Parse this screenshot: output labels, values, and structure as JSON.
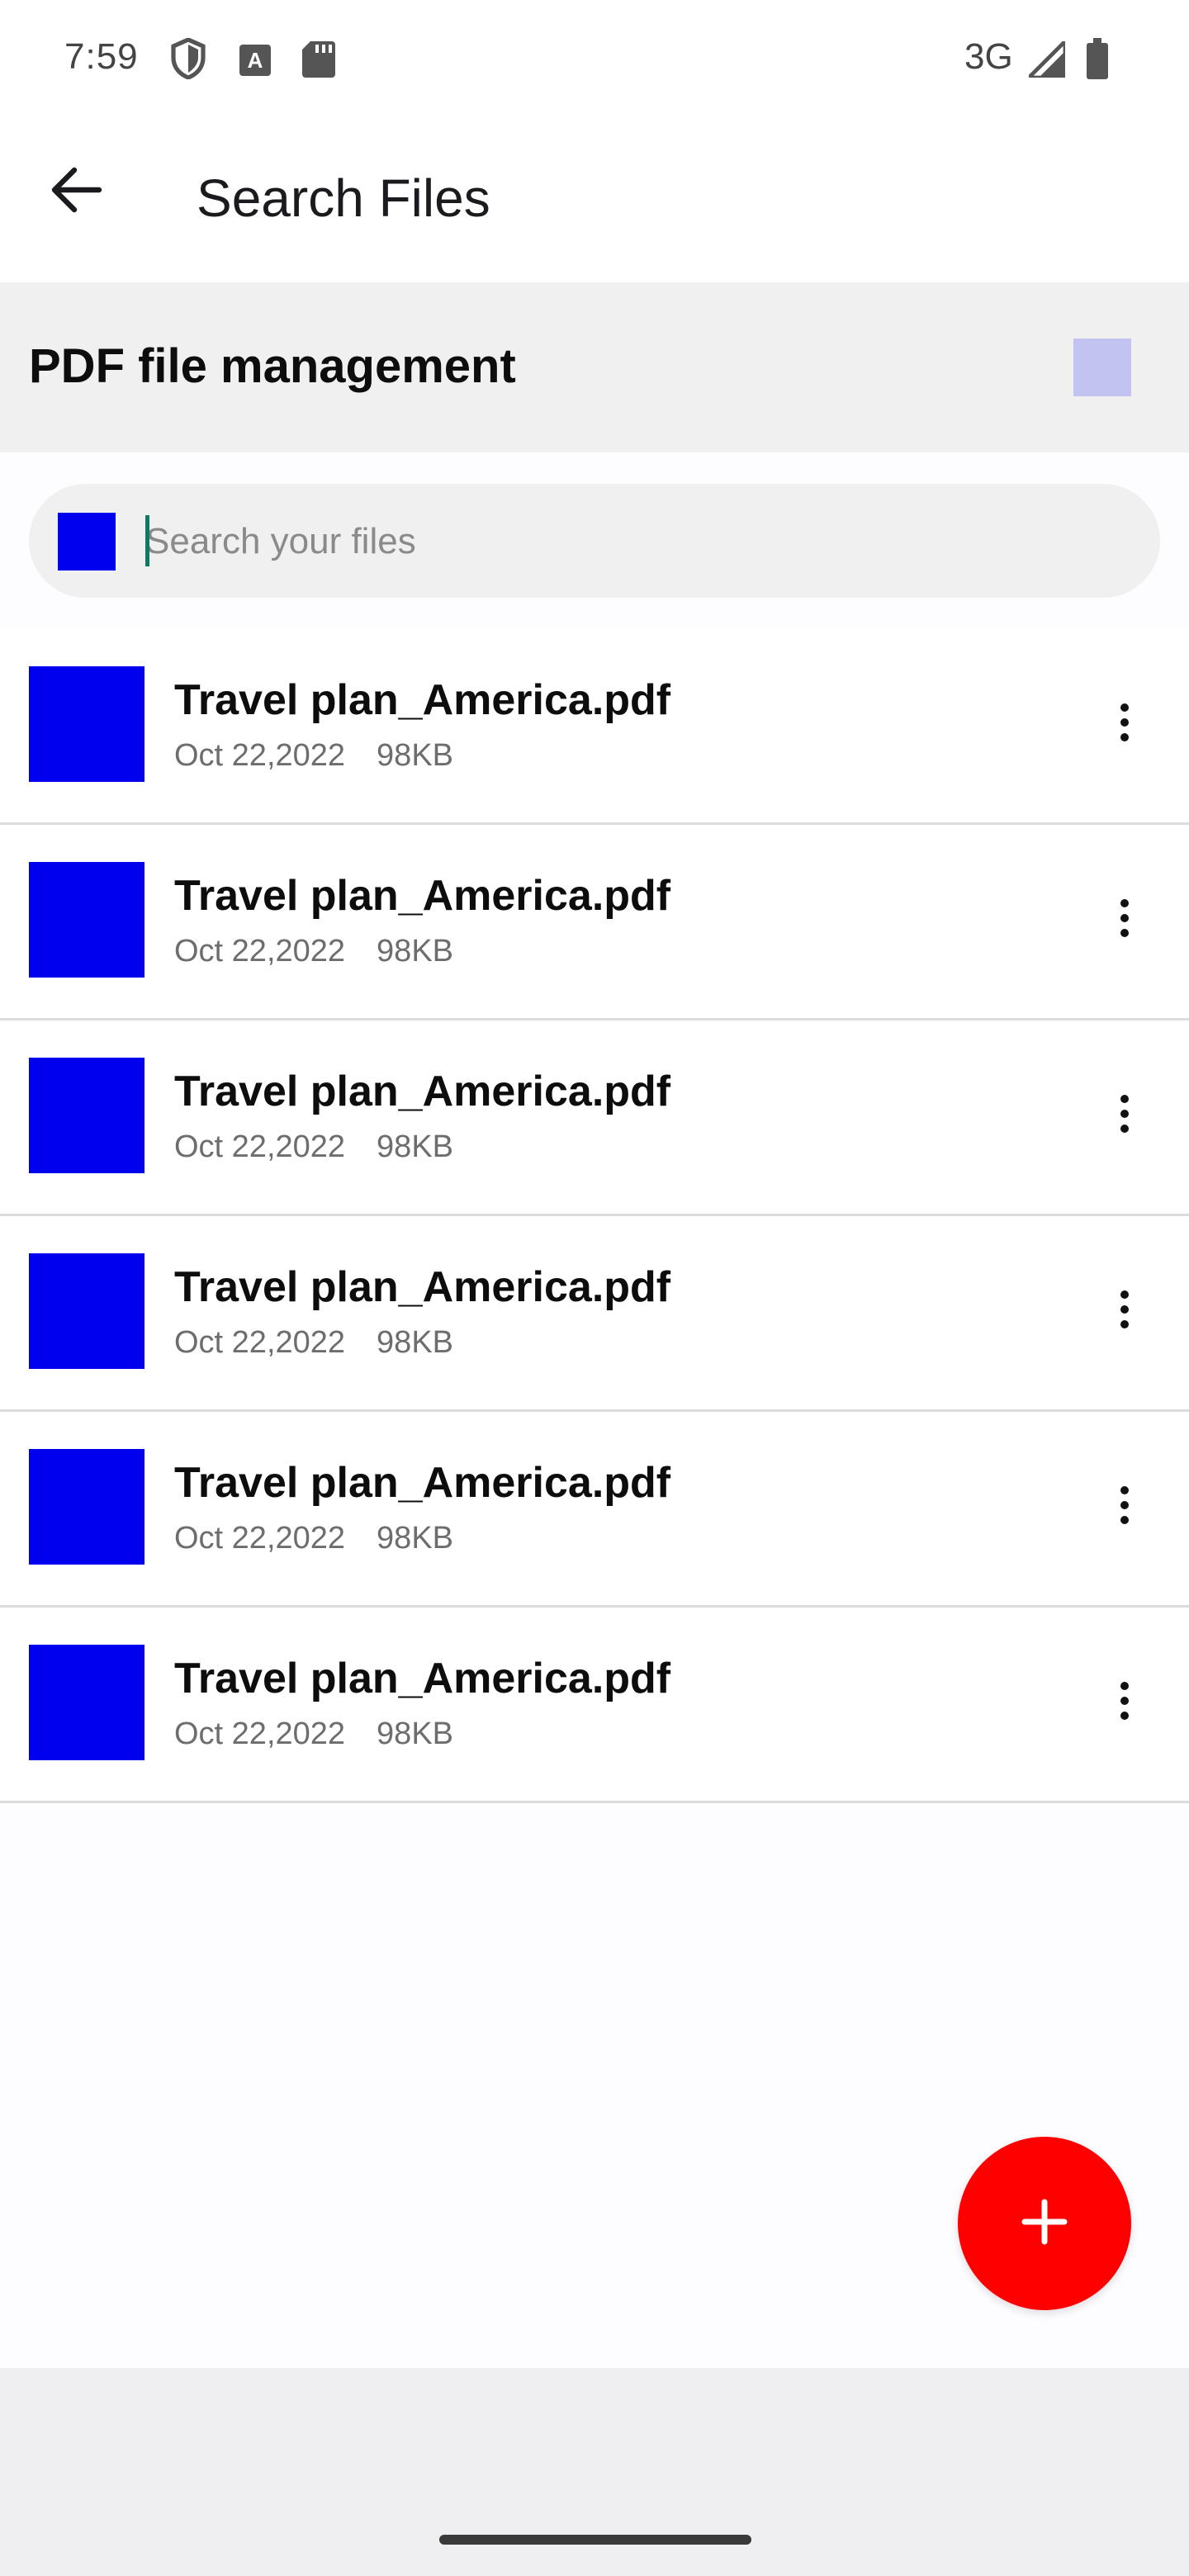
{
  "status_bar": {
    "time": "7:59",
    "network": "3G",
    "icons": [
      "shield-icon",
      "a-box-icon",
      "sd-card-icon",
      "signal-icon",
      "battery-icon"
    ]
  },
  "header": {
    "title": "Search Files",
    "back_icon": "arrow-left-icon"
  },
  "section": {
    "title": "PDF file management",
    "accent_color": "#c3c3f2"
  },
  "search": {
    "placeholder": "Search your files",
    "value": ""
  },
  "files": [
    {
      "name": "Travel plan_America.pdf",
      "date": "Oct 22,2022",
      "size": "98KB"
    },
    {
      "name": "Travel plan_America.pdf",
      "date": "Oct 22,2022",
      "size": "98KB"
    },
    {
      "name": "Travel plan_America.pdf",
      "date": "Oct 22,2022",
      "size": "98KB"
    },
    {
      "name": "Travel plan_America.pdf",
      "date": "Oct 22,2022",
      "size": "98KB"
    },
    {
      "name": "Travel plan_America.pdf",
      "date": "Oct 22,2022",
      "size": "98KB"
    },
    {
      "name": "Travel plan_America.pdf",
      "date": "Oct 22,2022",
      "size": "98KB"
    }
  ],
  "fab": {
    "icon": "plus-icon",
    "color": "#ff0000"
  },
  "colors": {
    "thumb": "#0000ee",
    "cursor": "#0e7a63"
  }
}
